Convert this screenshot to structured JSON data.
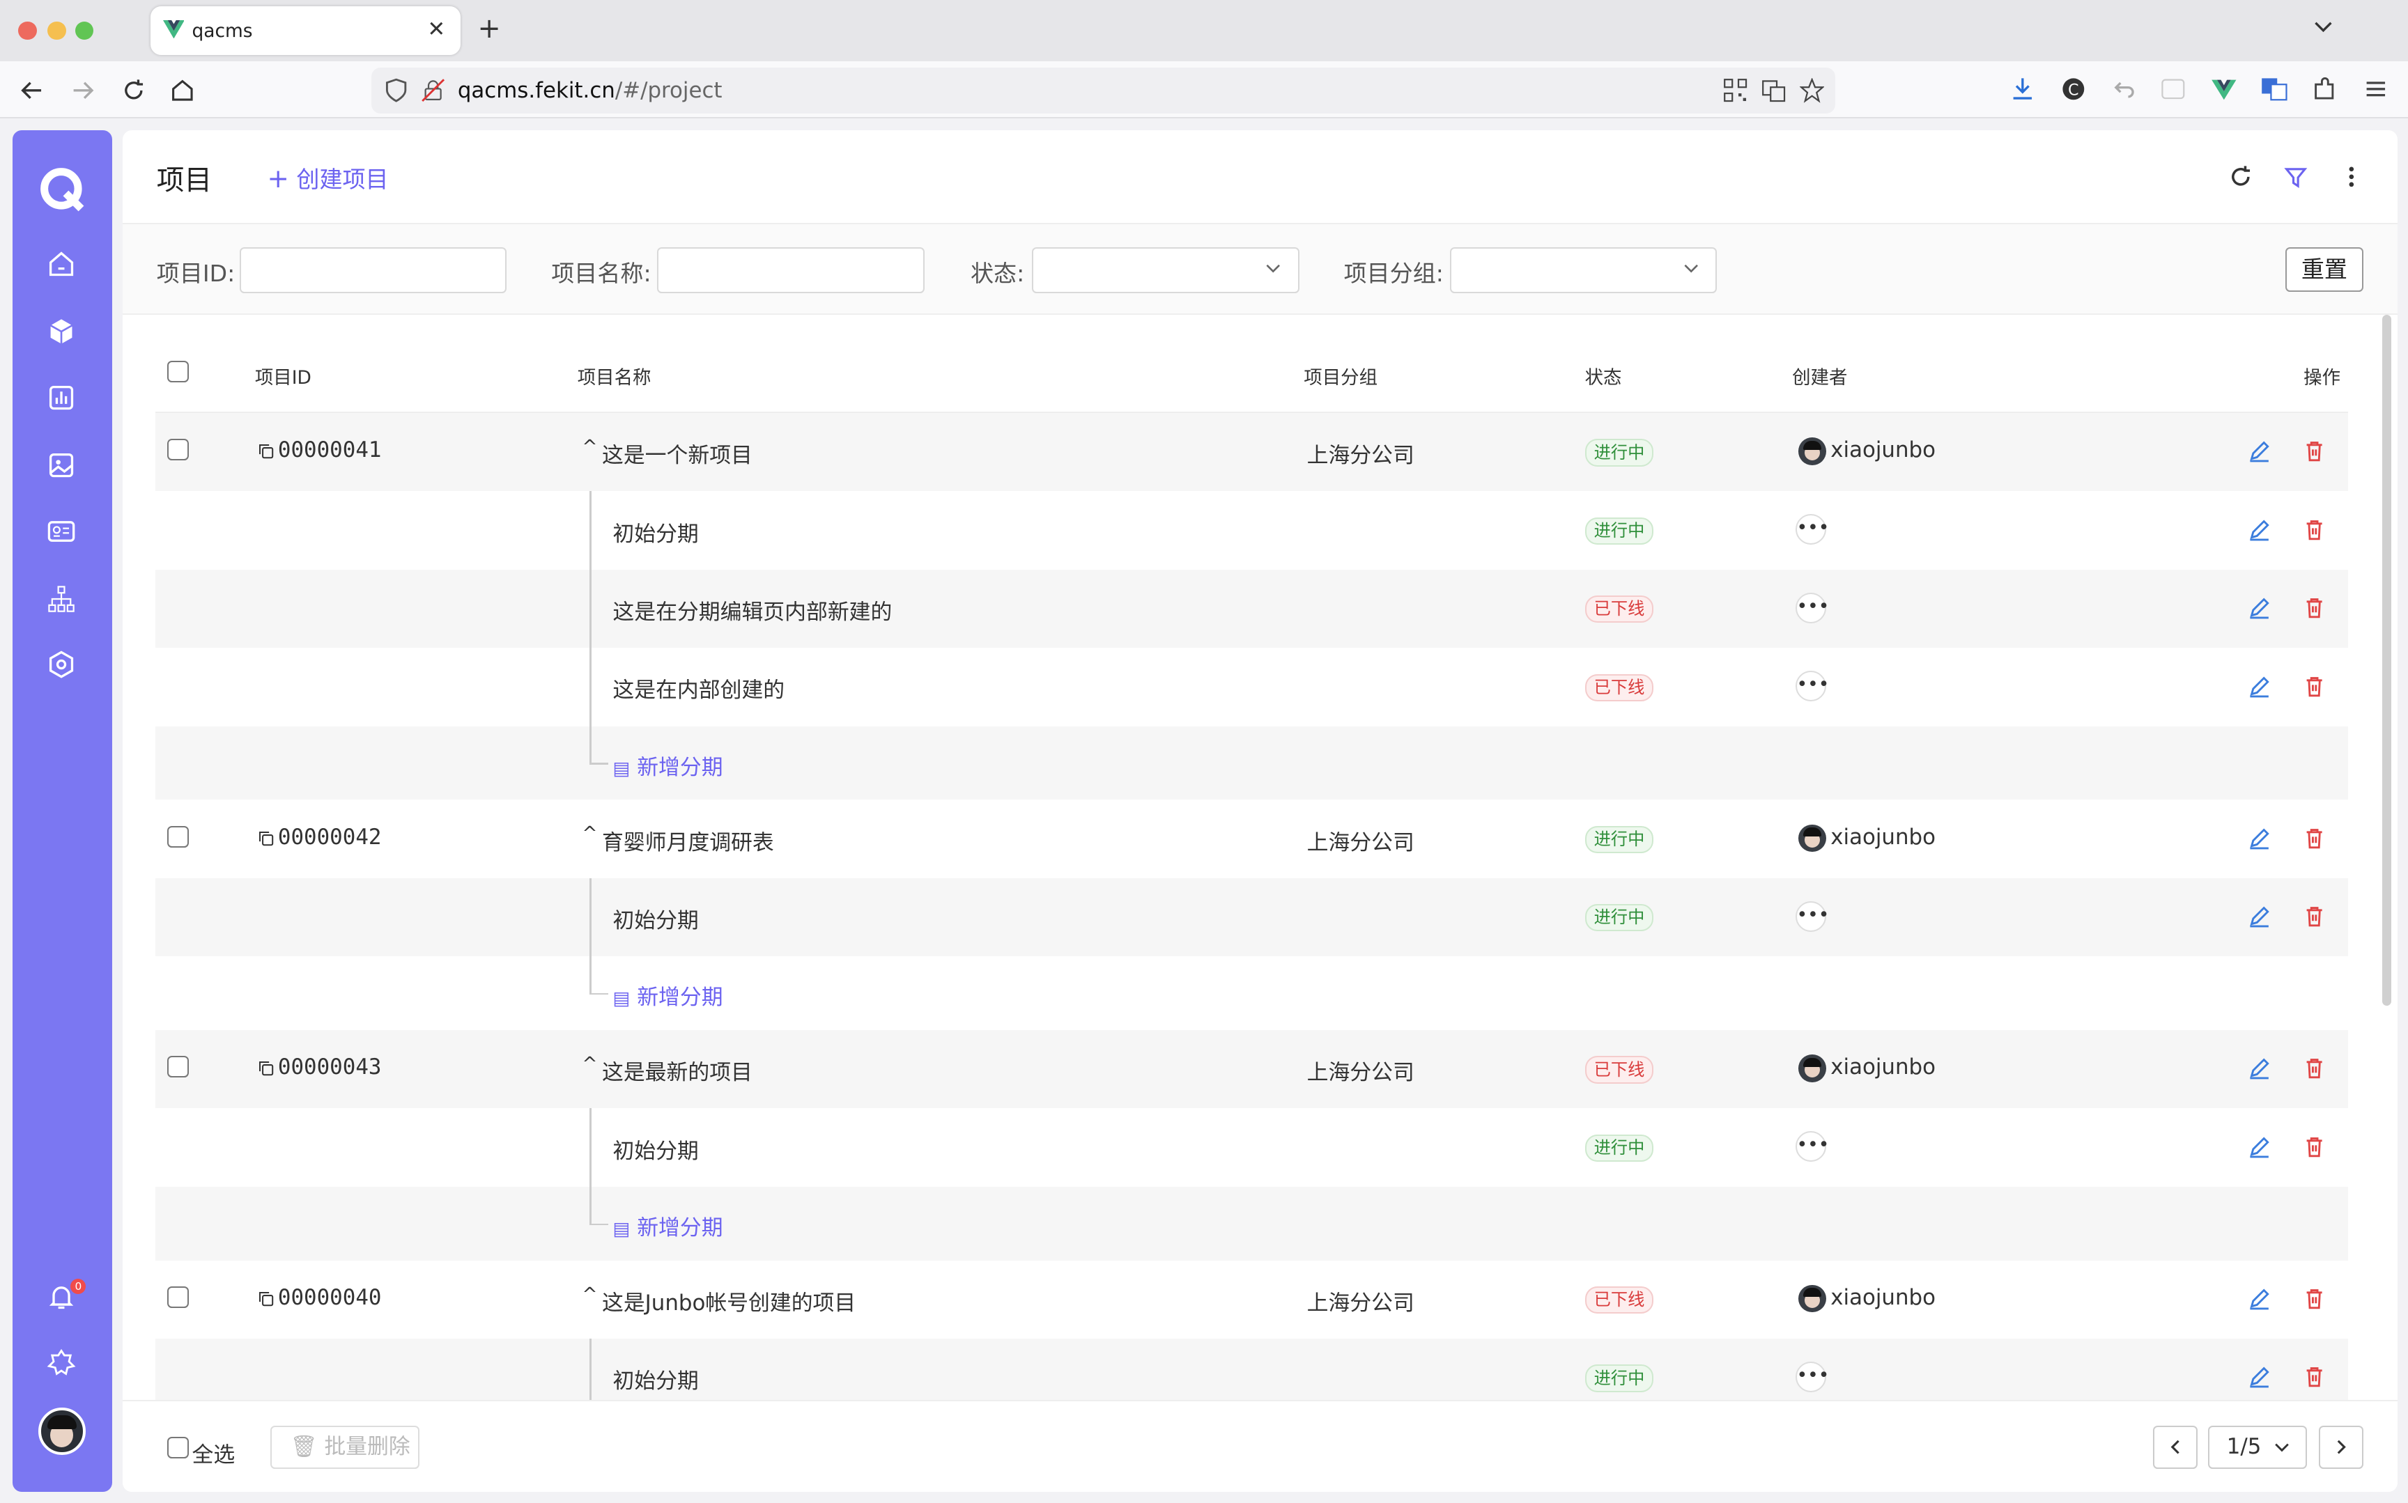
{
  "browser": {
    "tab_title": "qacms",
    "url_host": "qacms.fekit.cn",
    "url_path": "/#/project"
  },
  "header": {
    "title": "项目",
    "create_label": "创建项目"
  },
  "filters": {
    "id_label": "项目ID:",
    "name_label": "项目名称:",
    "status_label": "状态:",
    "group_label": "项目分组:",
    "reset_label": "重置"
  },
  "table": {
    "columns": {
      "id": "项目ID",
      "name": "项目名称",
      "group": "项目分组",
      "status": "状态",
      "creator": "创建者",
      "actions": "操作"
    },
    "projects": [
      {
        "id": "00000041",
        "name": "这是一个新项目",
        "group": "上海分公司",
        "status": "进行中",
        "creator": "xiaojunbo",
        "phases": [
          {
            "name": "初始分期",
            "status": "进行中"
          },
          {
            "name": "这是在分期编辑页内部新建的",
            "status": "已下线"
          },
          {
            "name": "这是在内部创建的",
            "status": "已下线"
          }
        ]
      },
      {
        "id": "00000042",
        "name": "育婴师月度调研表",
        "group": "上海分公司",
        "status": "进行中",
        "creator": "xiaojunbo",
        "phases": [
          {
            "name": "初始分期",
            "status": "进行中"
          }
        ]
      },
      {
        "id": "00000043",
        "name": "这是最新的项目",
        "group": "上海分公司",
        "status": "已下线",
        "creator": "xiaojunbo",
        "phases": [
          {
            "name": "初始分期",
            "status": "进行中"
          }
        ]
      },
      {
        "id": "00000040",
        "name": "这是Junbo帐号创建的项目",
        "group": "上海分公司",
        "status": "已下线",
        "creator": "xiaojunbo",
        "phases": [
          {
            "name": "初始分期",
            "status": "进行中"
          }
        ]
      }
    ],
    "add_phase_label": "新增分期"
  },
  "footer": {
    "select_all_label": "全选",
    "bulk_delete_label": "批量删除",
    "page_label": "1/5"
  },
  "sidebar": {
    "notification_count": "0"
  },
  "colors": {
    "accent": "#6c63f0",
    "sidebar": "#7b77f2",
    "status_active": "#2f8f3a",
    "status_offline": "#d93b3b"
  }
}
